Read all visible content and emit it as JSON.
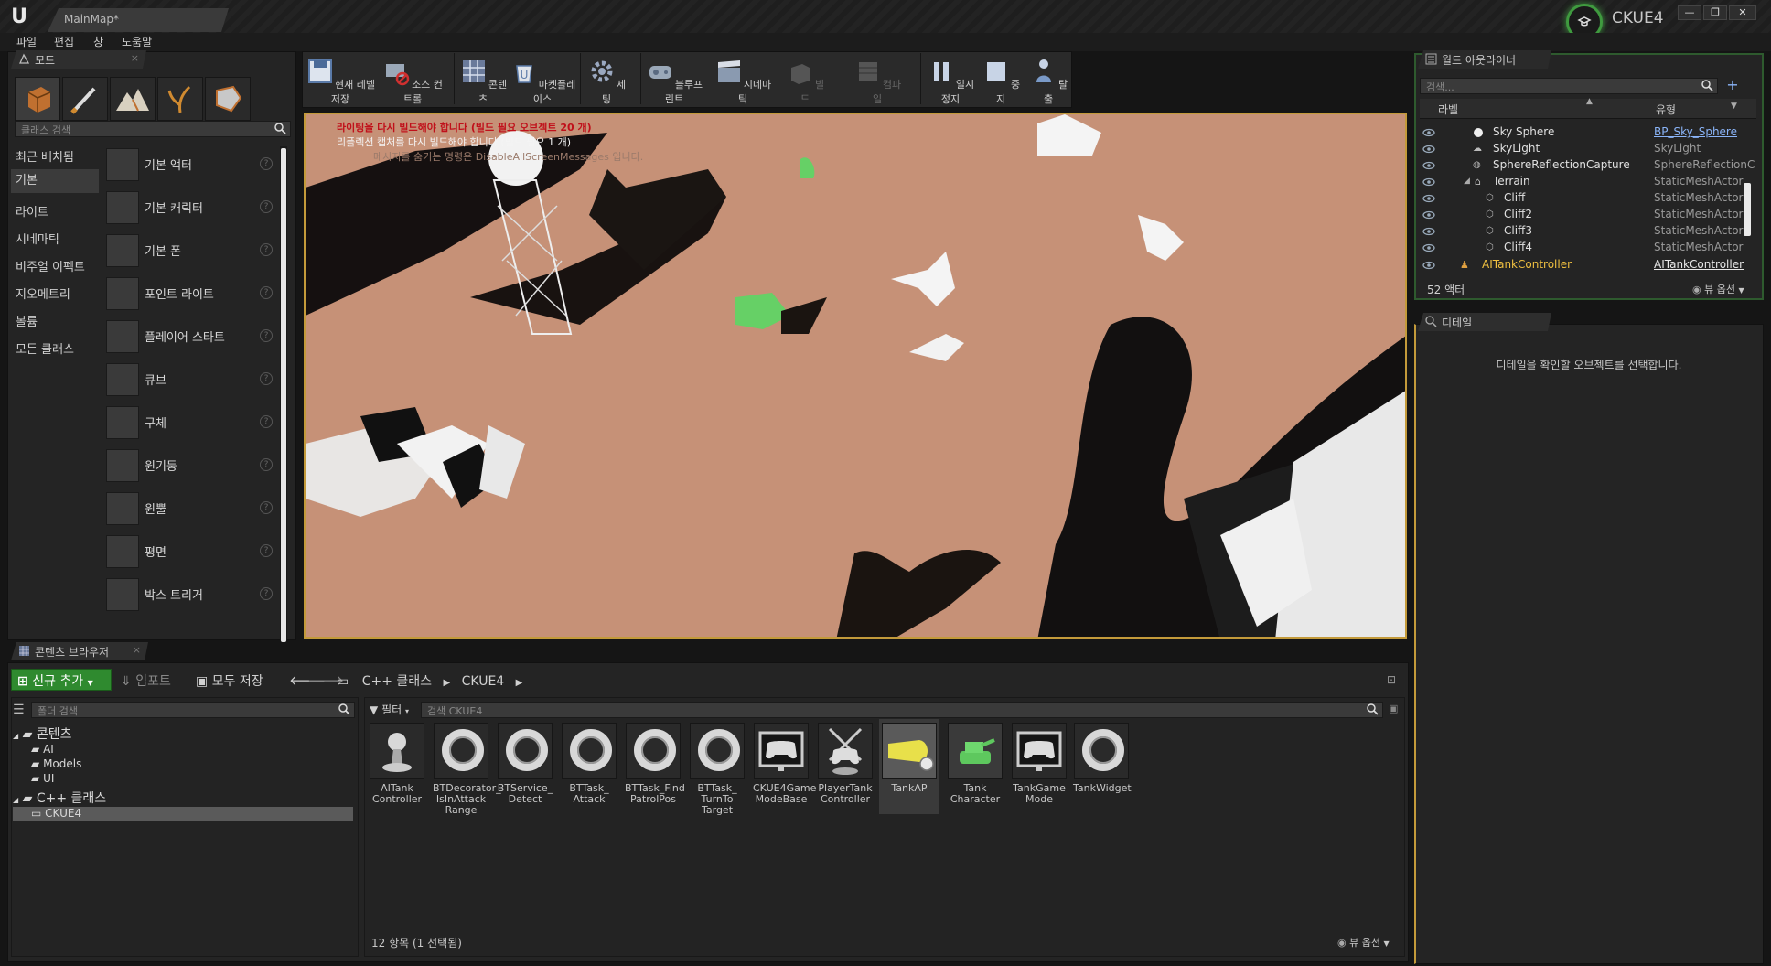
{
  "window": {
    "tab_title": "MainMap*",
    "project_name": "CKUE4",
    "minimize": "—",
    "restore": "❐",
    "close": "✕"
  },
  "menu": [
    "파일",
    "편집",
    "창",
    "도움말"
  ],
  "modes_panel": {
    "tab_label": "모드",
    "search_placeholder": "클래스 검색",
    "categories": [
      "최근 배치됨",
      "기본",
      "라이트",
      "시네마틱",
      "비주얼 이펙트",
      "지오메트리",
      "볼륨",
      "모든 클래스"
    ],
    "active_category": "기본",
    "items": [
      "기본 액터",
      "기본 캐릭터",
      "기본 폰",
      "포인트 라이트",
      "플레이어 스타트",
      "큐브",
      "구체",
      "원기둥",
      "원뿔",
      "평면",
      "박스 트리거"
    ],
    "help": "?"
  },
  "toolbar": {
    "buttons": [
      "현재 레벨 저장",
      "소스 컨트롤",
      "콘텐츠",
      "마켓플레이스",
      "세팅",
      "블루프린트",
      "시네마틱",
      "빌드",
      "컴파일",
      "일시정지",
      "중지",
      "탈출"
    ]
  },
  "viewport": {
    "msg1": "라이팅을 다시 빌드해야 합니다 (빌드 필요 오브젝트 20 개)",
    "msg2": "리플렉션 캡처를 다시 빌드해야 합니다 (빌드 필요 1 개)",
    "msg3": "메시지를 숨기는 명령은 DisableAllScreenMessages 입니다."
  },
  "outliner": {
    "tab_label": "월드 아웃라이너",
    "search_placeholder": "검색...",
    "col_label": "라벨",
    "col_type": "유형",
    "rows": [
      {
        "name": "Sky Sphere",
        "type": "BP_Sky_Sphere",
        "link": true
      },
      {
        "name": "SkyLight",
        "type": "SkyLight",
        "link": false
      },
      {
        "name": "SphereReflectionCapture",
        "type": "SphereReflectionC",
        "link": false
      },
      {
        "name": "Terrain",
        "type": "StaticMeshActor",
        "link": false
      },
      {
        "name": "Cliff",
        "type": "StaticMeshActor",
        "link": false
      },
      {
        "name": "Cliff2",
        "type": "StaticMeshActor",
        "link": false
      },
      {
        "name": "Cliff3",
        "type": "StaticMeshActor",
        "link": false
      },
      {
        "name": "Cliff4",
        "type": "StaticMeshActor",
        "link": false
      },
      {
        "name": "AITankController",
        "type": "AITankController",
        "link": true
      }
    ],
    "actor_count": "52 액터",
    "view_options": "뷰 옵션"
  },
  "details": {
    "tab_label": "디테일",
    "empty_msg": "디테일을 확인할 오브젝트를 선택합니다."
  },
  "content_browser": {
    "tab_label": "콘텐츠 브라우저",
    "add_new": "신규 추가",
    "import": "임포트",
    "save_all": "모두 저장",
    "path": [
      "C++ 클래스",
      "CKUE4"
    ],
    "folder_search_placeholder": "폴더 검색",
    "filter": "필터",
    "search_placeholder": "검색 CKUE4",
    "tree": {
      "content": "콘텐츠",
      "content_children": [
        "AI",
        "Models",
        "UI"
      ],
      "cpp": "C++ 클래스",
      "cpp_children": [
        "CKUE4"
      ]
    },
    "assets": [
      {
        "label": "AITank Controller",
        "kind": "pawn-icon"
      },
      {
        "label": "BTDecorator_ IsInAttack Range",
        "kind": "ring-icon"
      },
      {
        "label": "BTService_ Detect",
        "kind": "ring-icon"
      },
      {
        "label": "BTTask_ Attack",
        "kind": "ring-icon"
      },
      {
        "label": "BTTask_Find PatrolPos",
        "kind": "ring-icon"
      },
      {
        "label": "BTTask_ TurnTo Target",
        "kind": "ring-icon"
      },
      {
        "label": "CKUE4Game ModeBase",
        "kind": "gamepad-icon"
      },
      {
        "label": "PlayerTank Controller",
        "kind": "controller-icon"
      },
      {
        "label": "TankAP",
        "kind": "projectile-icon"
      },
      {
        "label": "Tank Character",
        "kind": "tank-icon"
      },
      {
        "label": "TankGame Mode",
        "kind": "gamepad-icon"
      },
      {
        "label": "TankWidget",
        "kind": "ring-icon"
      }
    ],
    "selected_asset": "TankAP",
    "status": "12 항목 (1 선택됨)",
    "view_options": "뷰 옵션"
  }
}
